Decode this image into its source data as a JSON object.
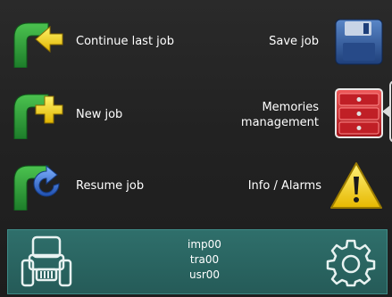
{
  "menu": {
    "continue_last_job": "Continue last job",
    "save_job": "Save job",
    "new_job": "New job",
    "memories_line1": "Memories",
    "memories_line2": "management",
    "resume_job": "Resume job",
    "info_alarms": "Info / Alarms"
  },
  "status": {
    "user_lines": [
      "imp00",
      "tra00",
      "usr00"
    ]
  },
  "icons": {
    "continue": "green-arrow-left-icon",
    "save": "floppy-disk-icon",
    "new": "green-arrow-plus-icon",
    "memories": "red-drawer-cabinet-icon",
    "resume": "green-arrow-blue-circular-icon",
    "alarm": "warning-triangle-icon",
    "tractor": "tractor-icon",
    "settings": "gear-icon"
  },
  "colors": {
    "green_arrow": "#2f9e3a",
    "yellow_accent": "#f2d21a",
    "blue_accent": "#2f6fd0",
    "red_cabinet": "#c8232a",
    "panel_teal": "#2f6f6b"
  }
}
